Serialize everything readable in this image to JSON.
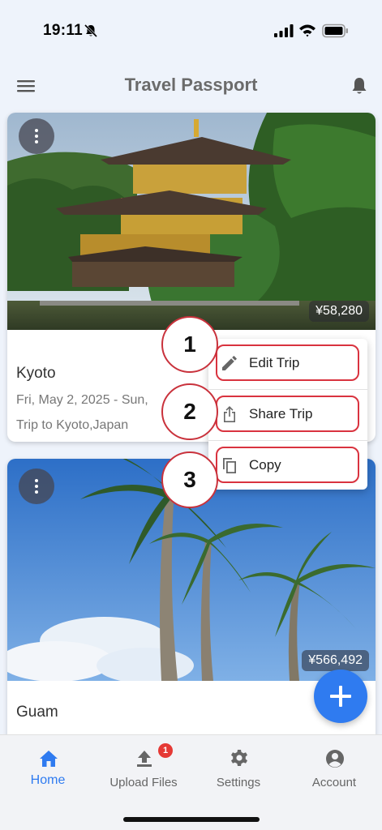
{
  "status_bar": {
    "time": "19:11"
  },
  "app_bar": {
    "title": "Travel Passport"
  },
  "trips": [
    {
      "title": "Kyoto",
      "dates": "Fri, May 2, 2025 - Sun,",
      "description": "Trip to Kyoto,Japan",
      "price": "¥58,280"
    },
    {
      "title": "Guam",
      "price": "¥566,492"
    }
  ],
  "context_menu": {
    "items": [
      {
        "label": "Edit Trip",
        "icon": "pencil-icon",
        "step": "1"
      },
      {
        "label": "Share Trip",
        "icon": "share-icon",
        "step": "2"
      },
      {
        "label": "Copy",
        "icon": "copy-icon",
        "step": "3"
      }
    ]
  },
  "bottom_nav": {
    "items": [
      {
        "label": "Home",
        "icon": "home-icon",
        "active": true
      },
      {
        "label": "Upload Files",
        "icon": "upload-icon",
        "badge": "1"
      },
      {
        "label": "Settings",
        "icon": "gear-icon"
      },
      {
        "label": "Account",
        "icon": "account-icon"
      }
    ]
  },
  "colors": {
    "accent": "#2f7bf0",
    "highlight": "#d9333f",
    "badge": "#e53935"
  }
}
